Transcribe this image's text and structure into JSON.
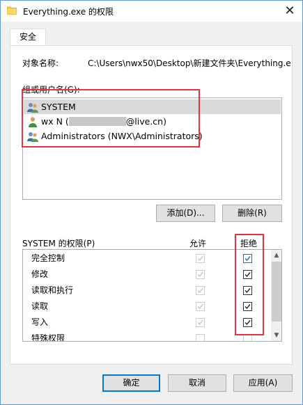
{
  "window": {
    "title": "Everything.exe 的权限",
    "close_glyph": "✕",
    "folder_color": "#f5c342"
  },
  "tabs": [
    {
      "label": "安全"
    }
  ],
  "object": {
    "label": "对象名称:",
    "value": "C:\\Users\\nwx50\\Desktop\\新建文件夹\\Everything.e"
  },
  "users": {
    "label": "组或用户名(G):",
    "items": [
      {
        "name": "SYSTEM",
        "icon": "users-group-icon",
        "selected": true
      },
      {
        "name_prefix": "wx N (",
        "name_suffix": "@live.cn)",
        "icon": "user-icon",
        "selected": false
      },
      {
        "name": "Administrators (NWX\\Administrators)",
        "icon": "users-group-icon",
        "selected": false
      }
    ]
  },
  "buttons": {
    "add": "添加(D)...",
    "remove": "删除(R)",
    "ok": "确定",
    "cancel": "取消",
    "apply": "应用(A)"
  },
  "permissions": {
    "label": "SYSTEM 的权限(P)",
    "allow_header": "允许",
    "deny_header": "拒绝",
    "rows": [
      {
        "name": "完全控制",
        "allow": true,
        "deny": true
      },
      {
        "name": "修改",
        "allow": true,
        "deny": true
      },
      {
        "name": "读取和执行",
        "allow": true,
        "deny": true
      },
      {
        "name": "读取",
        "allow": true,
        "deny": true
      },
      {
        "name": "写入",
        "allow": true,
        "deny": true
      },
      {
        "name": "特殊权限",
        "allow": false,
        "deny": false
      }
    ]
  },
  "colors": {
    "accent": "#0078d7",
    "highlight_red": "#e5323a",
    "selection": "#d9d9d9"
  }
}
